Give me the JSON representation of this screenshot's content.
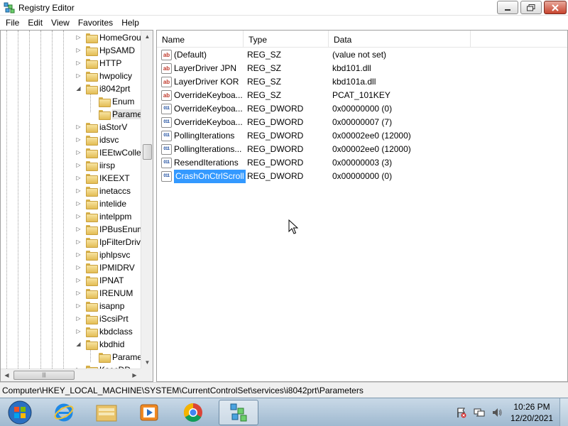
{
  "window": {
    "title": "Registry Editor",
    "controls": {
      "minimize": "–",
      "maximize": "□",
      "close": "✕"
    }
  },
  "menu": [
    "File",
    "Edit",
    "View",
    "Favorites",
    "Help"
  ],
  "tree": {
    "items": [
      {
        "label": "HomeGrou",
        "expander": "▷"
      },
      {
        "label": "HpSAMD",
        "expander": "▷"
      },
      {
        "label": "HTTP",
        "expander": "▷"
      },
      {
        "label": "hwpolicy",
        "expander": "▷"
      },
      {
        "label": "i8042prt",
        "expander": "◢"
      },
      {
        "label": "Enum",
        "expander": ""
      },
      {
        "label": "Parame",
        "expander": ""
      },
      {
        "label": "iaStorV",
        "expander": "▷"
      },
      {
        "label": "idsvc",
        "expander": "▷"
      },
      {
        "label": "IEEtwColle",
        "expander": "▷"
      },
      {
        "label": "iirsp",
        "expander": "▷"
      },
      {
        "label": "IKEEXT",
        "expander": "▷"
      },
      {
        "label": "inetaccs",
        "expander": "▷"
      },
      {
        "label": "intelide",
        "expander": "▷"
      },
      {
        "label": "intelppm",
        "expander": "▷"
      },
      {
        "label": "IPBusEnum",
        "expander": "▷"
      },
      {
        "label": "IpFilterDriv",
        "expander": "▷"
      },
      {
        "label": "iphlpsvc",
        "expander": "▷"
      },
      {
        "label": "IPMIDRV",
        "expander": "▷"
      },
      {
        "label": "IPNAT",
        "expander": "▷"
      },
      {
        "label": "IRENUM",
        "expander": "▷"
      },
      {
        "label": "isapnp",
        "expander": "▷"
      },
      {
        "label": "iScsiPrt",
        "expander": "▷"
      },
      {
        "label": "kbdclass",
        "expander": "▷"
      },
      {
        "label": "kbdhid",
        "expander": "◢"
      },
      {
        "label": "Parame",
        "expander": ""
      },
      {
        "label": "KsecDD",
        "expander": "▷"
      }
    ],
    "hscroll_grip": "|||"
  },
  "list": {
    "columns": [
      "Name",
      "Type",
      "Data"
    ],
    "rows": [
      {
        "icon": "ab",
        "name": "(Default)",
        "type": "REG_SZ",
        "data": "(value not set)"
      },
      {
        "icon": "ab",
        "name": "LayerDriver JPN",
        "type": "REG_SZ",
        "data": "kbd101.dll"
      },
      {
        "icon": "ab",
        "name": "LayerDriver KOR",
        "type": "REG_SZ",
        "data": "kbd101a.dll"
      },
      {
        "icon": "ab",
        "name": "OverrideKeyboa...",
        "type": "REG_SZ",
        "data": "PCAT_101KEY"
      },
      {
        "icon": "011",
        "name": "OverrideKeyboa...",
        "type": "REG_DWORD",
        "data": "0x00000000 (0)"
      },
      {
        "icon": "011",
        "name": "OverrideKeyboa...",
        "type": "REG_DWORD",
        "data": "0x00000007 (7)"
      },
      {
        "icon": "011",
        "name": "PollingIterations",
        "type": "REG_DWORD",
        "data": "0x00002ee0 (12000)"
      },
      {
        "icon": "011",
        "name": "PollingIterations...",
        "type": "REG_DWORD",
        "data": "0x00002ee0 (12000)"
      },
      {
        "icon": "011",
        "name": "ResendIterations",
        "type": "REG_DWORD",
        "data": "0x00000003 (3)"
      },
      {
        "icon": "011",
        "name": "CrashOnCtrlScroll",
        "type": "REG_DWORD",
        "data": "0x00000000 (0)"
      }
    ]
  },
  "status": {
    "path": "Computer\\HKEY_LOCAL_MACHINE\\SYSTEM\\CurrentControlSet\\services\\i8042prt\\Parameters"
  },
  "taskbar": {
    "time": "10:26 PM",
    "date": "12/20/2021"
  },
  "colors": {
    "selection": "#3399ff",
    "taskbar": "#b4c9da",
    "close_button": "#c7442e"
  }
}
